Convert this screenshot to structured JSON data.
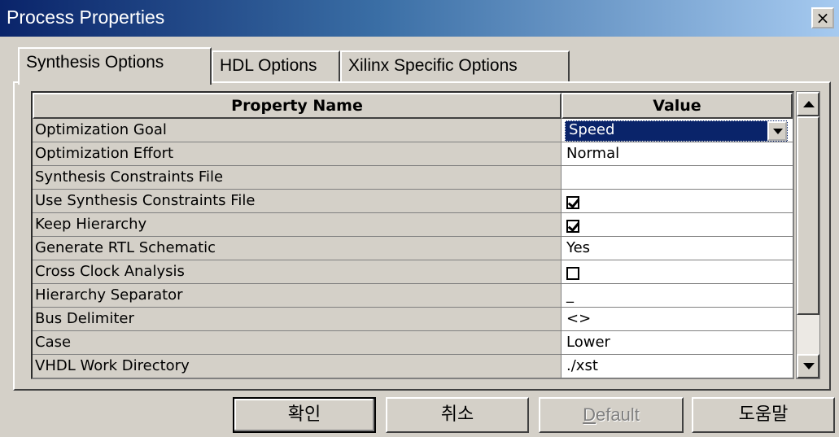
{
  "window": {
    "title": "Process Properties",
    "close_label": "×"
  },
  "tabs": [
    {
      "label": "Synthesis Options"
    },
    {
      "label": "HDL Options"
    },
    {
      "label": "Xilinx Specific Options"
    }
  ],
  "grid": {
    "headers": {
      "name": "Property Name",
      "value": "Value"
    },
    "rows": [
      {
        "name": "Optimization Goal",
        "value": "Speed",
        "type": "dropdown"
      },
      {
        "name": "Optimization Effort",
        "value": "Normal",
        "type": "text"
      },
      {
        "name": "Synthesis Constraints File",
        "value": "",
        "type": "text"
      },
      {
        "name": "Use Synthesis Constraints File",
        "value": "checked",
        "type": "checkbox"
      },
      {
        "name": "Keep Hierarchy",
        "value": "checked",
        "type": "checkbox"
      },
      {
        "name": "Generate RTL Schematic",
        "value": "Yes",
        "type": "text"
      },
      {
        "name": "Cross Clock Analysis",
        "value": "unchecked",
        "type": "checkbox"
      },
      {
        "name": "Hierarchy Separator",
        "value": "_",
        "type": "text"
      },
      {
        "name": "Bus Delimiter",
        "value": "<>",
        "type": "text"
      },
      {
        "name": "Case",
        "value": "Lower",
        "type": "text"
      },
      {
        "name": "VHDL Work Directory",
        "value": "./xst",
        "type": "text"
      }
    ]
  },
  "buttons": {
    "ok": "확인",
    "cancel": "취소",
    "default": "Default",
    "help": "도움말"
  },
  "colors": {
    "selection": "#0a246a",
    "face": "#d4d0c8"
  }
}
